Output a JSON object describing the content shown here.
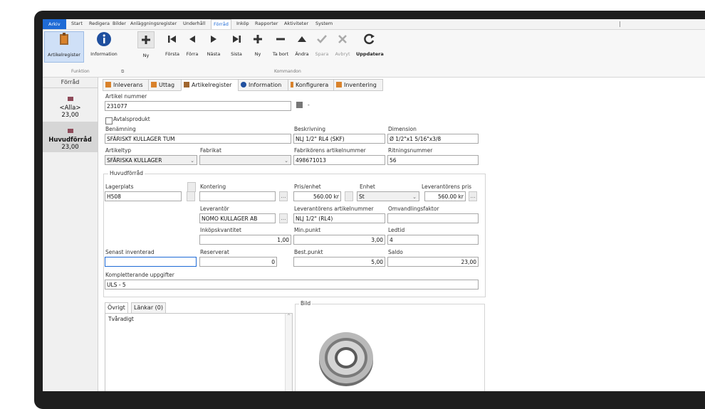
{
  "menu": {
    "items": [
      "Arkiv",
      "Start",
      "Redigera",
      "Bilder",
      "Anläggningsregister",
      "Underhåll",
      "Förråd",
      "Inköp",
      "Rapporter",
      "Aktiviteter",
      "System"
    ]
  },
  "ribbon": {
    "buttons": {
      "artikelregister": "Artikelregister",
      "information": "Information",
      "ny1": "Ny",
      "forsta": "Första",
      "forra": "Förra",
      "nasta": "Nästa",
      "sista": "Sista",
      "ny2": "Ny",
      "tabort": "Ta bort",
      "andra": "Ändra",
      "spara": "Spara",
      "avbryt": "Avbryt",
      "uppdatera": "Uppdatera"
    },
    "groups": {
      "funktion": "Funktion",
      "kommandon": "Kommandon"
    }
  },
  "sidebar": {
    "header": "Förråd",
    "items": [
      {
        "name": "<Alla>",
        "value": "23,00"
      },
      {
        "name": "Huvudförråd",
        "value": "23,00"
      }
    ]
  },
  "tabs": [
    "Inleverans",
    "Uttag",
    "Artikelregister",
    "Information",
    "Konfigurera",
    "Inventering"
  ],
  "form": {
    "artikel_nummer_label": "Artikel nummer",
    "artikel_nummer": "231077",
    "suffix": "-",
    "avtalsprodukt_label": "Avtalsprodukt",
    "benamning_label": "Benämning",
    "benamning": "SFÄRISKT KULLAGER TUM",
    "beskrivning_label": "Beskrivning",
    "beskrivning": "NLJ 1/2\"  RL4 (SKF)",
    "dimension_label": "Dimension",
    "dimension": "Ø 1/2\"x1 5/16\"x3/8",
    "artikeltyp_label": "Artikeltyp",
    "artikeltyp": "SFÄRISKA KULLAGER",
    "fabrikat_label": "Fabrikat",
    "fabrikat": "",
    "fabrikorens_label": "Fabrikörens artikelnummer",
    "fabrikorens": "498671013",
    "ritningsnummer_label": "Ritningsnummer",
    "ritningsnummer": "56",
    "huvudforrad_legend": "Huvudförråd",
    "lagerplats_label": "Lagerplats",
    "lagerplats": "H508",
    "kontering_label": "Kontering",
    "kontering": "",
    "pris_label": "Pris/enhet",
    "pris": "560.00 kr",
    "enhet_label": "Enhet",
    "enhet": "St",
    "lev_pris_label": "Leverantörens pris",
    "lev_pris": "560.00 kr",
    "leverantor_label": "Leverantör",
    "leverantor": "NOMO KULLAGER AB",
    "lev_artnr_label": "Leverantörens artikelnummer",
    "lev_artnr": "NLJ 1/2\" (RL4)",
    "omvandling_label": "Omvandlingsfaktor",
    "omvandling": "",
    "inkopskvant_label": "Inköpskvantitet",
    "inkopskvant": "1,00",
    "minpunkt_label": "Min.punkt",
    "minpunkt": "3,00",
    "ledtid_label": "Ledtid",
    "ledtid": "4",
    "senast_label": "Senast inventerad",
    "senast": "",
    "reserverat_label": "Reserverat",
    "reserverat": "0",
    "bestpunkt_label": "Best.punkt",
    "bestpunkt": "5,00",
    "saldo_label": "Saldo",
    "saldo": "23,00",
    "kompl_label": "Kompletterande uppgifter",
    "kompl": "ULS - 5"
  },
  "lower": {
    "tab_ovrigt": "Övrigt",
    "tab_lankar": "Länkar (0)",
    "ovrigt_text": "Tvåradigt",
    "bild_label": "Bild"
  },
  "colors": {
    "accent": "#1f6bd6",
    "icon_orange": "#d9822b",
    "frame": "#1e1e1e"
  }
}
